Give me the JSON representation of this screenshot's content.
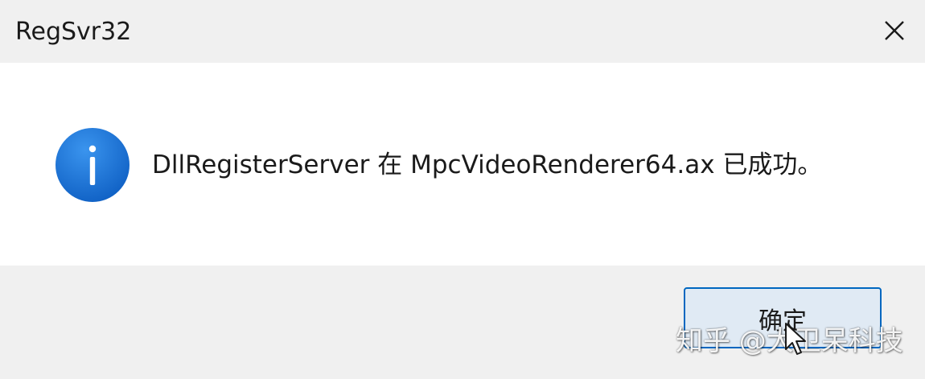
{
  "window": {
    "title": "RegSvr32"
  },
  "dialog": {
    "icon": "info-icon",
    "message": "DllRegisterServer 在 MpcVideoRenderer64.ax 已成功。",
    "ok_label": "确定"
  },
  "overlay": {
    "watermark": "知乎 @大卫呆科技"
  },
  "colors": {
    "accent": "#0067c0",
    "icon_blue": "#1a73d8",
    "content_bg": "#ffffff",
    "chrome_bg": "#f0f0f0"
  }
}
